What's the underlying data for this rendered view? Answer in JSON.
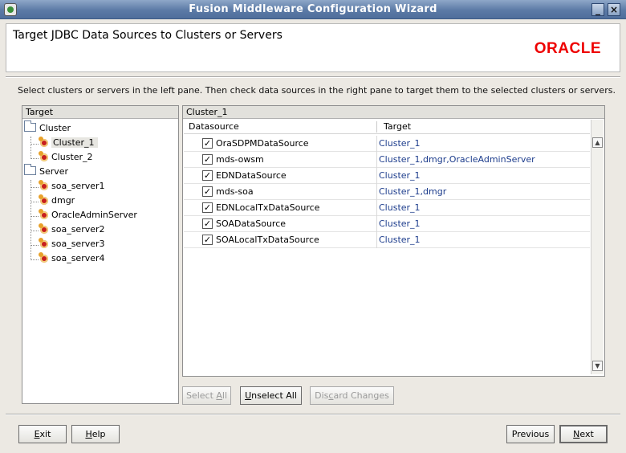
{
  "window": {
    "title": "Fusion Middleware Configuration Wizard",
    "minimize_glyph": "_",
    "close_glyph": "×"
  },
  "header": {
    "title": "Target JDBC Data Sources to Clusters or Servers",
    "logo": "ORACLE"
  },
  "instructions": "Select clusters or servers in the left pane.  Then check data sources in the right pane to target them to the selected clusters or servers.",
  "target_pane": {
    "header": "Target",
    "groups": [
      {
        "label": "Cluster",
        "items": [
          "Cluster_1",
          "Cluster_2"
        ]
      },
      {
        "label": "Server",
        "items": [
          "soa_server1",
          "dmgr",
          "OracleAdminServer",
          "soa_server2",
          "soa_server3",
          "soa_server4"
        ]
      }
    ],
    "selected": "Cluster_1"
  },
  "datasource_pane": {
    "header": "Cluster_1",
    "columns": [
      "Datasource",
      "Target"
    ],
    "rows": [
      {
        "name": "OraSDPMDataSource",
        "target": "Cluster_1",
        "checked": "✓"
      },
      {
        "name": "mds-owsm",
        "target": "Cluster_1,dmgr,OracleAdminServer",
        "checked": "✓"
      },
      {
        "name": "EDNDataSource",
        "target": "Cluster_1",
        "checked": "✓"
      },
      {
        "name": "mds-soa",
        "target": "Cluster_1,dmgr",
        "checked": "✓"
      },
      {
        "name": "EDNLocalTxDataSource",
        "target": "Cluster_1",
        "checked": "✓"
      },
      {
        "name": "SOADataSource",
        "target": "Cluster_1",
        "checked": "✓"
      },
      {
        "name": "SOALocalTxDataSource",
        "target": "Cluster_1",
        "checked": "✓"
      }
    ]
  },
  "actions": {
    "select_all": {
      "pre": "Select ",
      "ul": "A",
      "post": "ll"
    },
    "unselect_all": {
      "pre": "",
      "ul": "U",
      "post": "nselect All"
    },
    "discard_changes": {
      "pre": "Dis",
      "ul": "c",
      "post": "ard Changes"
    }
  },
  "footer": {
    "exit": {
      "pre": "",
      "ul": "E",
      "post": "xit"
    },
    "help": {
      "pre": "",
      "ul": "H",
      "post": "elp"
    },
    "previous": "Previous",
    "next": {
      "pre": "",
      "ul": "N",
      "post": "ext"
    }
  }
}
